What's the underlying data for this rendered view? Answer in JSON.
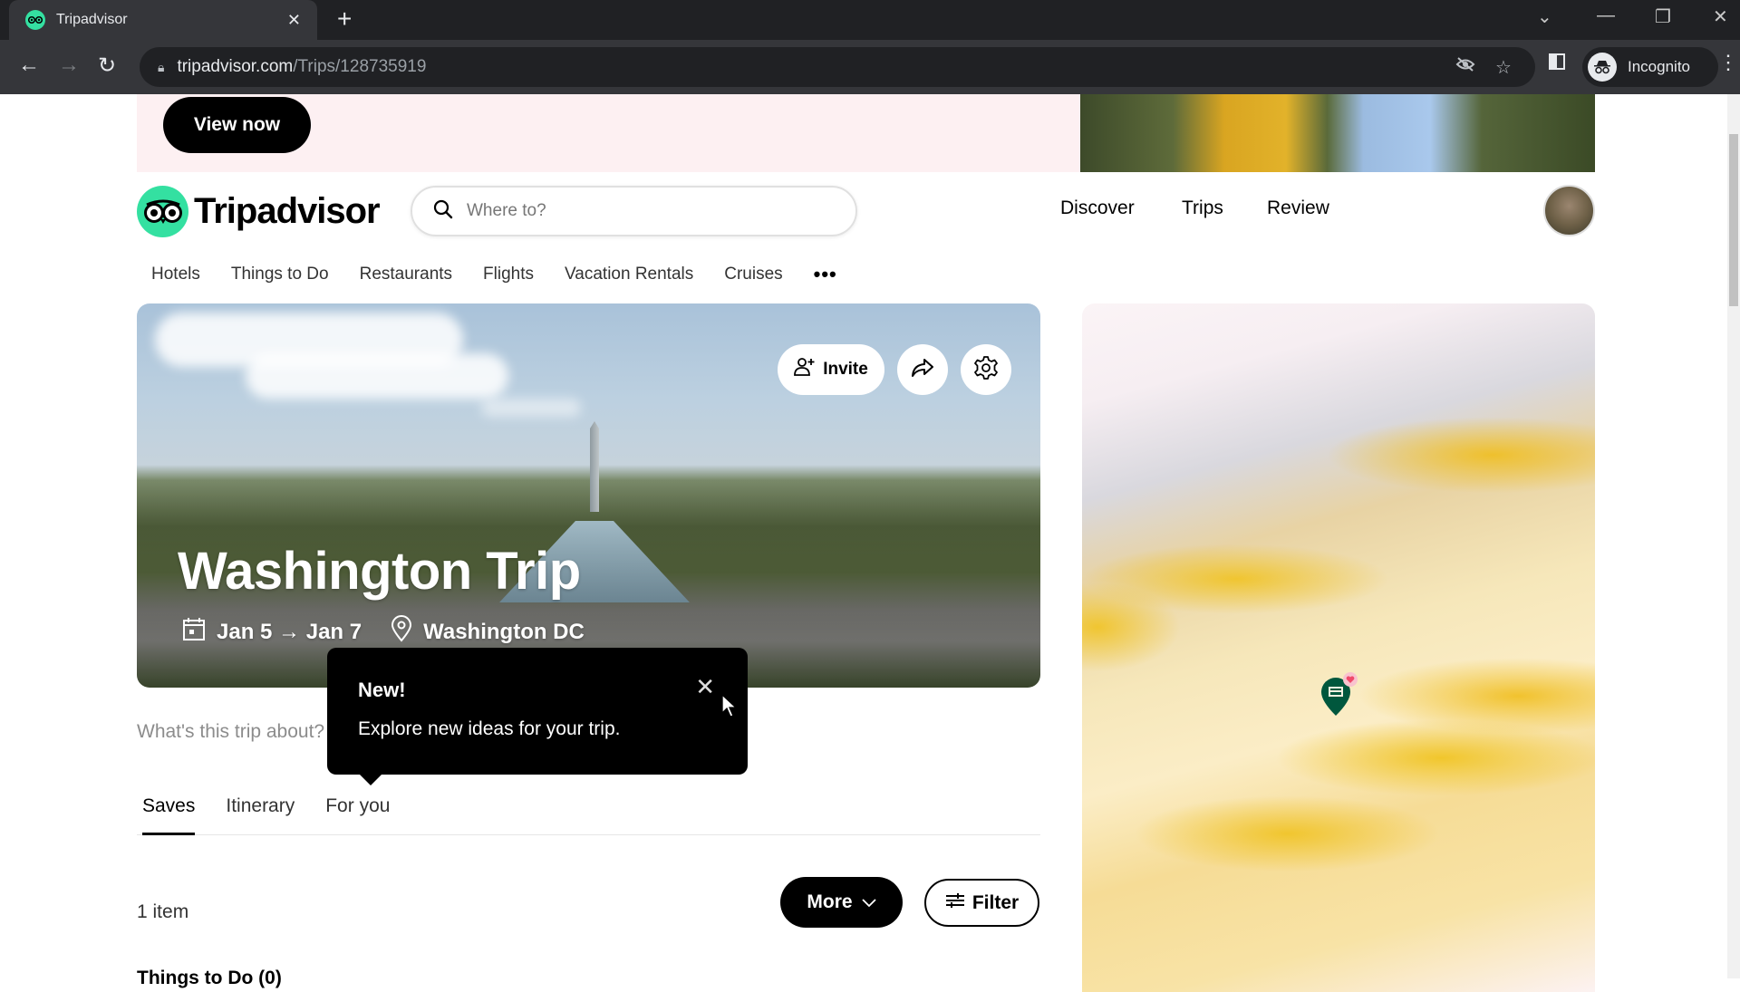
{
  "browser": {
    "tab_title": "Tripadvisor",
    "url_host": "tripadvisor.com",
    "url_path": "/Trips/128735919",
    "profile_label": "Incognito"
  },
  "ad": {
    "cta_label": "View now"
  },
  "header": {
    "brand": "Tripadvisor",
    "search_placeholder": "Where to?",
    "nav": [
      "Discover",
      "Trips",
      "Review"
    ]
  },
  "categories": [
    "Hotels",
    "Things to Do",
    "Restaurants",
    "Flights",
    "Vacation Rentals",
    "Cruises"
  ],
  "trip": {
    "title": "Washington Trip",
    "start_date": "Jan 5",
    "arrow": "→",
    "end_date": "Jan 7",
    "location": "Washington DC",
    "invite_label": "Invite",
    "description_placeholder": "What's this trip about?"
  },
  "tooltip": {
    "title": "New!",
    "body": "Explore new ideas for your trip."
  },
  "tabs": [
    {
      "label": "Saves",
      "active": true
    },
    {
      "label": "Itinerary",
      "active": false
    },
    {
      "label": "For you",
      "active": false
    }
  ],
  "saves": {
    "count_label": "1 item",
    "more_label": "More",
    "filter_label": "Filter",
    "section_heading": "Things to Do (0)"
  },
  "map": {
    "pins": [
      {
        "type": "hotel",
        "saved": true
      }
    ]
  },
  "colors": {
    "brand_green": "#34e0a1",
    "pin_green": "#00573d",
    "heart_pink": "#f04a6a"
  }
}
